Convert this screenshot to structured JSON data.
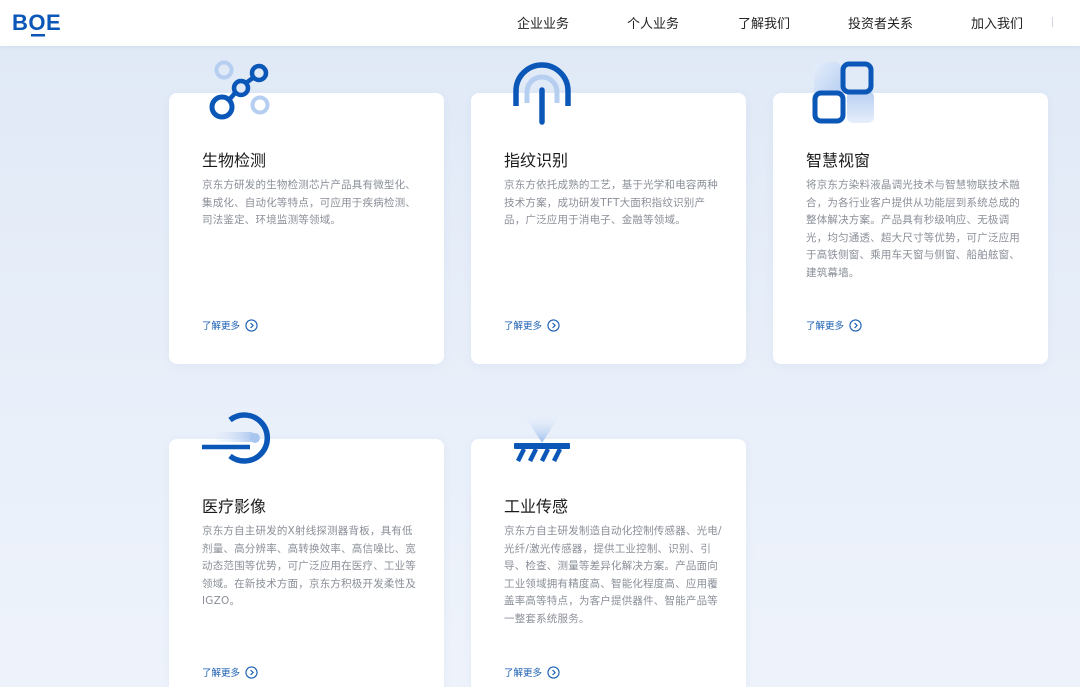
{
  "header": {
    "logo": "BOE",
    "nav": [
      "企业业务",
      "个人业务",
      "了解我们",
      "投资者关系",
      "加入我们"
    ]
  },
  "colors": {
    "brand": "#0b57b8",
    "accent_light": "#a9c6ef",
    "desc_text": "#8a8f98",
    "link": "#1a5fb4"
  },
  "cards": [
    {
      "icon": "molecule-icon",
      "title": "生物检测",
      "desc": "京东方研发的生物检测芯片产品具有微型化、集成化、自动化等特点，可应用于疾病检测、司法鉴定、环境监测等领域。",
      "more": "了解更多"
    },
    {
      "icon": "fingerprint-icon",
      "title": "指纹识别",
      "desc": "京东方依托成熟的工艺，基于光学和电容两种技术方案，成功研发TFT大面积指纹识别产品，广泛应用于消电子、金融等领域。",
      "more": "了解更多"
    },
    {
      "icon": "smart-window-icon",
      "title": "智慧视窗",
      "desc": "将京东方染料液晶调光技术与智慧物联技术融合，为各行业客户提供从功能层到系统总成的整体解决方案。产品具有秒级响应、无极调光，均匀通透、超大尺寸等优势，可广泛应用于高铁侧窗、乘用车天窗与侧窗、船舶舷窗、建筑幕墙。",
      "more": "了解更多"
    },
    {
      "icon": "xray-scan-icon",
      "title": "医疗影像",
      "desc": "京东方自主研发的X射线探测器背板，具有低剂量、高分辨率、高转换效率、高信噪比、宽动态范围等优势，可广泛应用在医疗、工业等领域。在新技术方面，京东方积极开发柔性及IGZO。",
      "more": "了解更多"
    },
    {
      "icon": "industrial-sensor-icon",
      "title": "工业传感",
      "desc": "京东方自主研发制造自动化控制传感器、光电/光纤/激光传感器，提供工业控制、识别、引导、检查、测量等差异化解决方案。产品面向工业领域拥有精度高、智能化程度高、应用覆盖率高等特点，为客户提供器件、智能产品等一整套系统服务。",
      "more": "了解更多"
    }
  ]
}
